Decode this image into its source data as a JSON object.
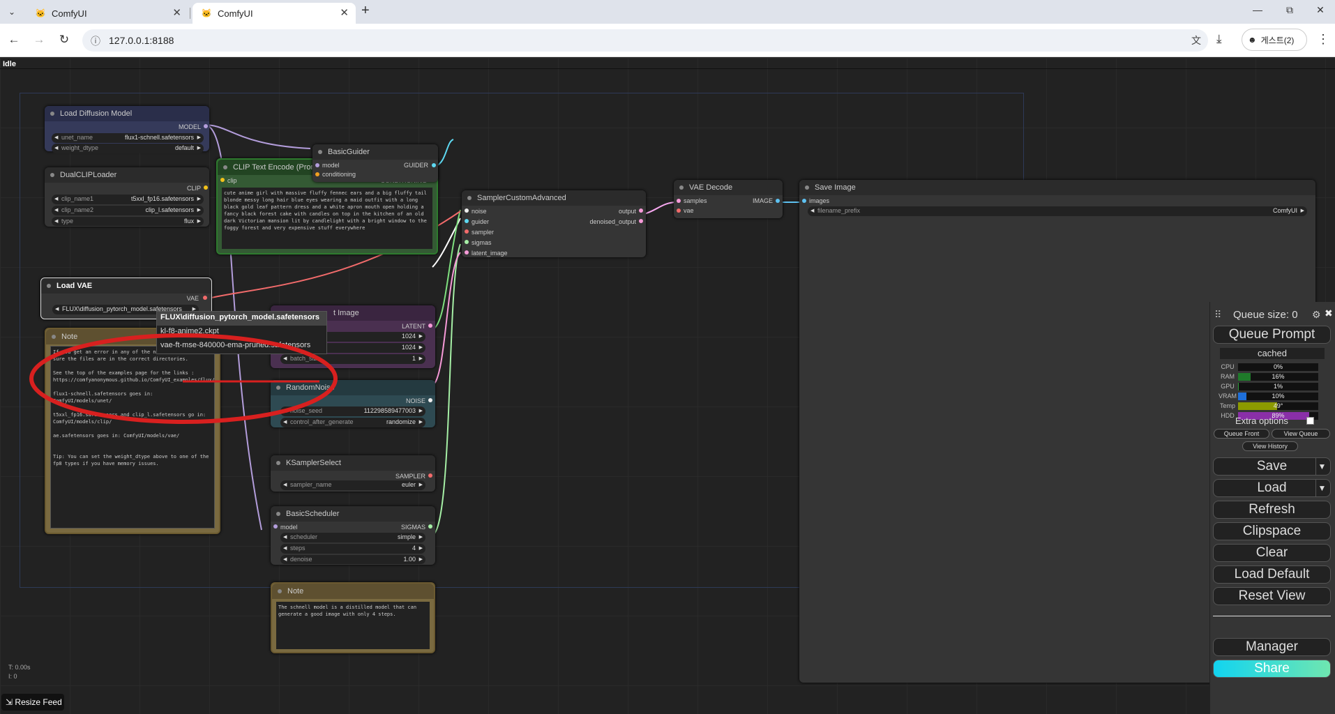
{
  "browser": {
    "tabs": [
      {
        "title": "ComfyUI"
      },
      {
        "title": "ComfyUI"
      }
    ],
    "url": "127.0.0.1:8188",
    "profile": "게스트(2)"
  },
  "status": "Idle",
  "nodes": {
    "load_diffusion": {
      "title": "Load Diffusion Model",
      "output": "MODEL",
      "unet_label": "unet_name",
      "unet_value": "flux1-schnell.safetensors",
      "dtype_label": "weight_dtype",
      "dtype_value": "default"
    },
    "dual_clip": {
      "title": "DualCLIPLoader",
      "output": "CLIP",
      "c1_label": "clip_name1",
      "c1_value": "t5xxl_fp16.safetensors",
      "c2_label": "clip_name2",
      "c2_value": "clip_l.safetensors",
      "type_label": "type",
      "type_value": "flux"
    },
    "load_vae": {
      "title": "Load VAE",
      "output": "VAE",
      "vae_value": "FLUX\\diffusion_pytorch_model.safetensors"
    },
    "note1": {
      "title": "Note",
      "text": "If you get an error in any of the nodes above make sure the files are in the correct directories.\n\nSee the top of the examples page for the links : https://comfyanonymous.github.io/ComfyUI_examples/flux/\n\nflux1-schnell.safetensors goes in: ComfyUI/models/unet/\n\nt5xxl_fp16.safetensors and clip_l.safetensors go in: ComfyUI/models/clip/\n\nae.safetensors goes in: ComfyUI/models/vae/\n\n\nTip: You can set the weight_dtype above to one of the fp8 types if you have memory issues."
    },
    "clip_encode": {
      "title": "CLIP Text Encode (Prompt)",
      "input": "clip",
      "output": "CONDITIONING",
      "text": "cute anime girl with massive fluffy fennec ears and a big fluffy tail blonde messy long hair blue eyes wearing a maid outfit with a long black gold leaf pattern dress and a white apron mouth open holding a fancy black forest cake with candles on top in the kitchen of an old dark Victorian mansion lit by candlelight with a bright window to the foggy forest and very expensive stuff everywhere"
    },
    "basic_guider": {
      "title": "BasicGuider",
      "in1": "model",
      "in2": "conditioning",
      "output": "GUIDER"
    },
    "empty_latent": {
      "title_partial": "t Image",
      "output": "LATENT",
      "width": "1024",
      "height": "1024",
      "batch_label": "batch_size",
      "batch_value": "1"
    },
    "random_noise": {
      "title": "RandomNoise",
      "output": "NOISE",
      "seed_label": "noise_seed",
      "seed_value": "112298589477003",
      "cag_label": "control_after_generate",
      "cag_value": "randomize"
    },
    "ksampler_select": {
      "title": "KSamplerSelect",
      "output": "SAMPLER",
      "label": "sampler_name",
      "value": "euler"
    },
    "basic_scheduler": {
      "title": "BasicScheduler",
      "input": "model",
      "output": "SIGMAS",
      "sch_label": "scheduler",
      "sch_value": "simple",
      "steps_label": "steps",
      "steps_value": "4",
      "den_label": "denoise",
      "den_value": "1.00"
    },
    "note2": {
      "title": "Note",
      "text": "The schnell model is a distilled model that can generate a good image with only 4 steps."
    },
    "sampler_custom": {
      "title": "SamplerCustomAdvanced",
      "inputs": [
        "noise",
        "guider",
        "sampler",
        "sigmas",
        "latent_image"
      ],
      "out1": "output",
      "out2": "denoised_output"
    },
    "vae_decode": {
      "title": "VAE Decode",
      "in1": "samples",
      "in2": "vae",
      "output": "IMAGE"
    },
    "save_image": {
      "title": "Save Image",
      "input": "images",
      "prefix_label": "filename_prefix",
      "prefix_value": "ComfyUI"
    }
  },
  "dropdown": {
    "items": [
      "FLUX\\diffusion_pytorch_model.safetensors",
      "kl-f8-anime2.ckpt",
      "vae-ft-mse-840000-ema-pruned.safetensors"
    ]
  },
  "panel": {
    "queue_size": "Queue size: 0",
    "queue_prompt": "Queue Prompt",
    "cached": "cached",
    "monitors": [
      {
        "label": "CPU",
        "value": "0%",
        "fill": 0.0,
        "color": "#2a9d3a"
      },
      {
        "label": "RAM",
        "value": "16%",
        "fill": 0.16,
        "color": "#1f7a2a"
      },
      {
        "label": "GPU",
        "value": "1%",
        "fill": 0.01,
        "color": "#2a9d3a"
      },
      {
        "label": "VRAM",
        "value": "10%",
        "fill": 0.1,
        "color": "#1e6fd9"
      },
      {
        "label": "Temp",
        "value": "49°",
        "fill": 0.49,
        "color": "#8c9a00"
      },
      {
        "label": "HDD",
        "value": "89%",
        "fill": 0.89,
        "color": "#8a2fa8"
      }
    ],
    "extra_options": "Extra options",
    "queue_front": "Queue Front",
    "view_queue": "View Queue",
    "view_history": "View History",
    "save": "Save",
    "load": "Load",
    "refresh": "Refresh",
    "clipspace": "Clipspace",
    "clear": "Clear",
    "load_default": "Load Default",
    "reset_view": "Reset View",
    "manager": "Manager",
    "share": "Share"
  },
  "bottom": {
    "t": "T: 0.00s",
    "i": "I: 0",
    "resize_feed": "Resize Feed"
  }
}
